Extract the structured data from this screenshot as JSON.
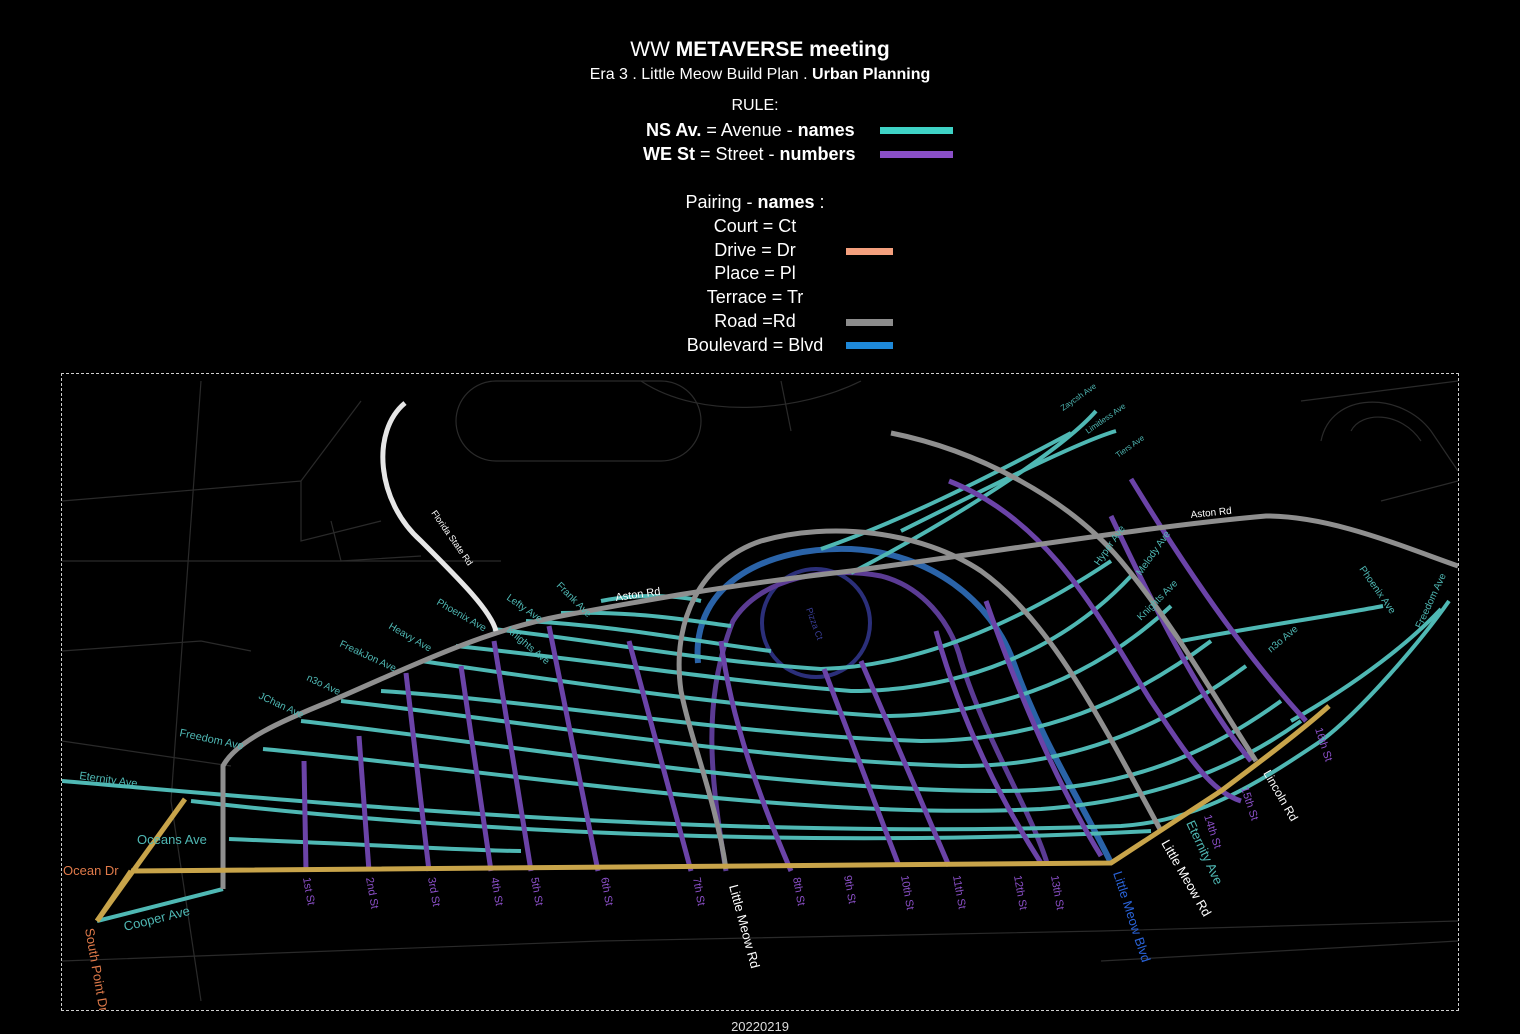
{
  "header": {
    "title_prefix": "WW",
    "title_bold": "METAVERSE meeting",
    "subtitle_prefix": "Era 3 . Little Meow Build Plan .",
    "subtitle_bold": "Urban Planning"
  },
  "legend": {
    "rule_heading": "RULE:",
    "rules": [
      {
        "bold": "NS Av.",
        "text": " = Avenue - ",
        "bold2": "names",
        "color": "#3fd3c6"
      },
      {
        "bold": "WE St",
        "text": " = Street - ",
        "bold2": "numbers",
        "color": "#8a4fc7"
      }
    ],
    "pairing_heading": "Pairing - ",
    "pairing_bold": "names",
    "pairing_colon": " :",
    "pairings": [
      {
        "text": "Court = Ct",
        "color": ""
      },
      {
        "text": "Drive = Dr",
        "color": "#f4a07e"
      },
      {
        "text": "Place = Pl",
        "color": ""
      },
      {
        "text": "Terrace = Tr",
        "color": ""
      },
      {
        "text": "Road =Rd",
        "color": "#8c8c8c"
      },
      {
        "text": "Boulevard = Blvd",
        "color": "#1e88d8"
      }
    ]
  },
  "map": {
    "colors": {
      "avenue": "#4fb8b4",
      "street": "#6b43a8",
      "road": "#8f8f8f",
      "boulevard": "#2a63a8",
      "drive": "#c8a44a",
      "white_road": "#e6e6e6",
      "circle": "#2b2f7a"
    },
    "labels": {
      "florida_state_rd": "Florida State Rd",
      "aston_rd_1": "Aston Rd",
      "aston_rd_2": "Aston Rd",
      "pizza_ct": "Pizza Ct",
      "lefty_ave": "Lefty Ave",
      "frank_ave": "Frank Ave",
      "phoenix_ave_w": "Phoenix Ave",
      "knights_ave_w": "Knights Ave",
      "heavy_ave": "Heavy Ave",
      "freakjon_ave": "FreakJon Ave",
      "n3o_ave_w": "n3o Ave",
      "jchan_ave": "JChan Ave",
      "freedom_ave_w": "Freedom Ave",
      "eternity_ave_w": "Eternity Ave",
      "oceans_ave": "Oceans Ave",
      "ocean_dr": "Ocean Dr",
      "cooper_ave": "Cooper Ave",
      "south_point_dr": "South Point Dr",
      "zaycsh_ave": "Zaycsh Ave",
      "limitless_ave": "Limitless Ave",
      "tiers_ave": "Tiers Ave",
      "hyper_ave": "Hyper Ave",
      "melody_ave": "Melody Ave",
      "knights_ave_e": "Knights Ave",
      "phoenix_ave_e": "Phoenix Ave",
      "freedom_ave_e": "Freedom Ave",
      "n3o_ave_e": "n3o Ave",
      "lincoln_rd": "Lincoln Rd",
      "little_meow_rd_w": "Little Meow Rd",
      "little_meow_rd_e": "Little Meow Rd",
      "little_meow_blvd": "Little Meow Blvd",
      "eternity_ave_e": "Eternity Ave",
      "streets": [
        "1st St",
        "2nd St",
        "3rd St",
        "4th St",
        "5th St",
        "6th St",
        "7th St",
        "8th St",
        "9th St",
        "10th St",
        "11th St",
        "12th St",
        "13th St",
        "14th St",
        "15th St",
        "16th St"
      ]
    }
  },
  "footer": {
    "text": "20220219"
  }
}
